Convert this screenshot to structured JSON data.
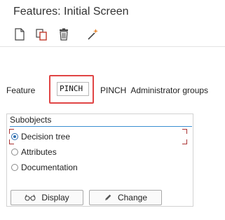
{
  "window": {
    "title": "Features: Initial Screen"
  },
  "toolbar": {
    "items": [
      {
        "icon": "new-document-icon"
      },
      {
        "icon": "copy-icon"
      },
      {
        "icon": "delete-icon"
      },
      {
        "icon": "magic-wand-icon"
      }
    ]
  },
  "feature": {
    "label": "Feature",
    "value": "PINCH",
    "description": "PINCH  Administrator groups"
  },
  "subobjects": {
    "title": "Subobjects",
    "options": [
      {
        "label": "Decision tree",
        "selected": true
      },
      {
        "label": "Attributes",
        "selected": false
      },
      {
        "label": "Documentation",
        "selected": false
      }
    ]
  },
  "buttons": {
    "display_label": "Display",
    "change_label": "Change"
  },
  "colors": {
    "highlight": "#e04545",
    "group_accent": "#3a8fd1",
    "radio_selected": "#2f6fb0"
  }
}
